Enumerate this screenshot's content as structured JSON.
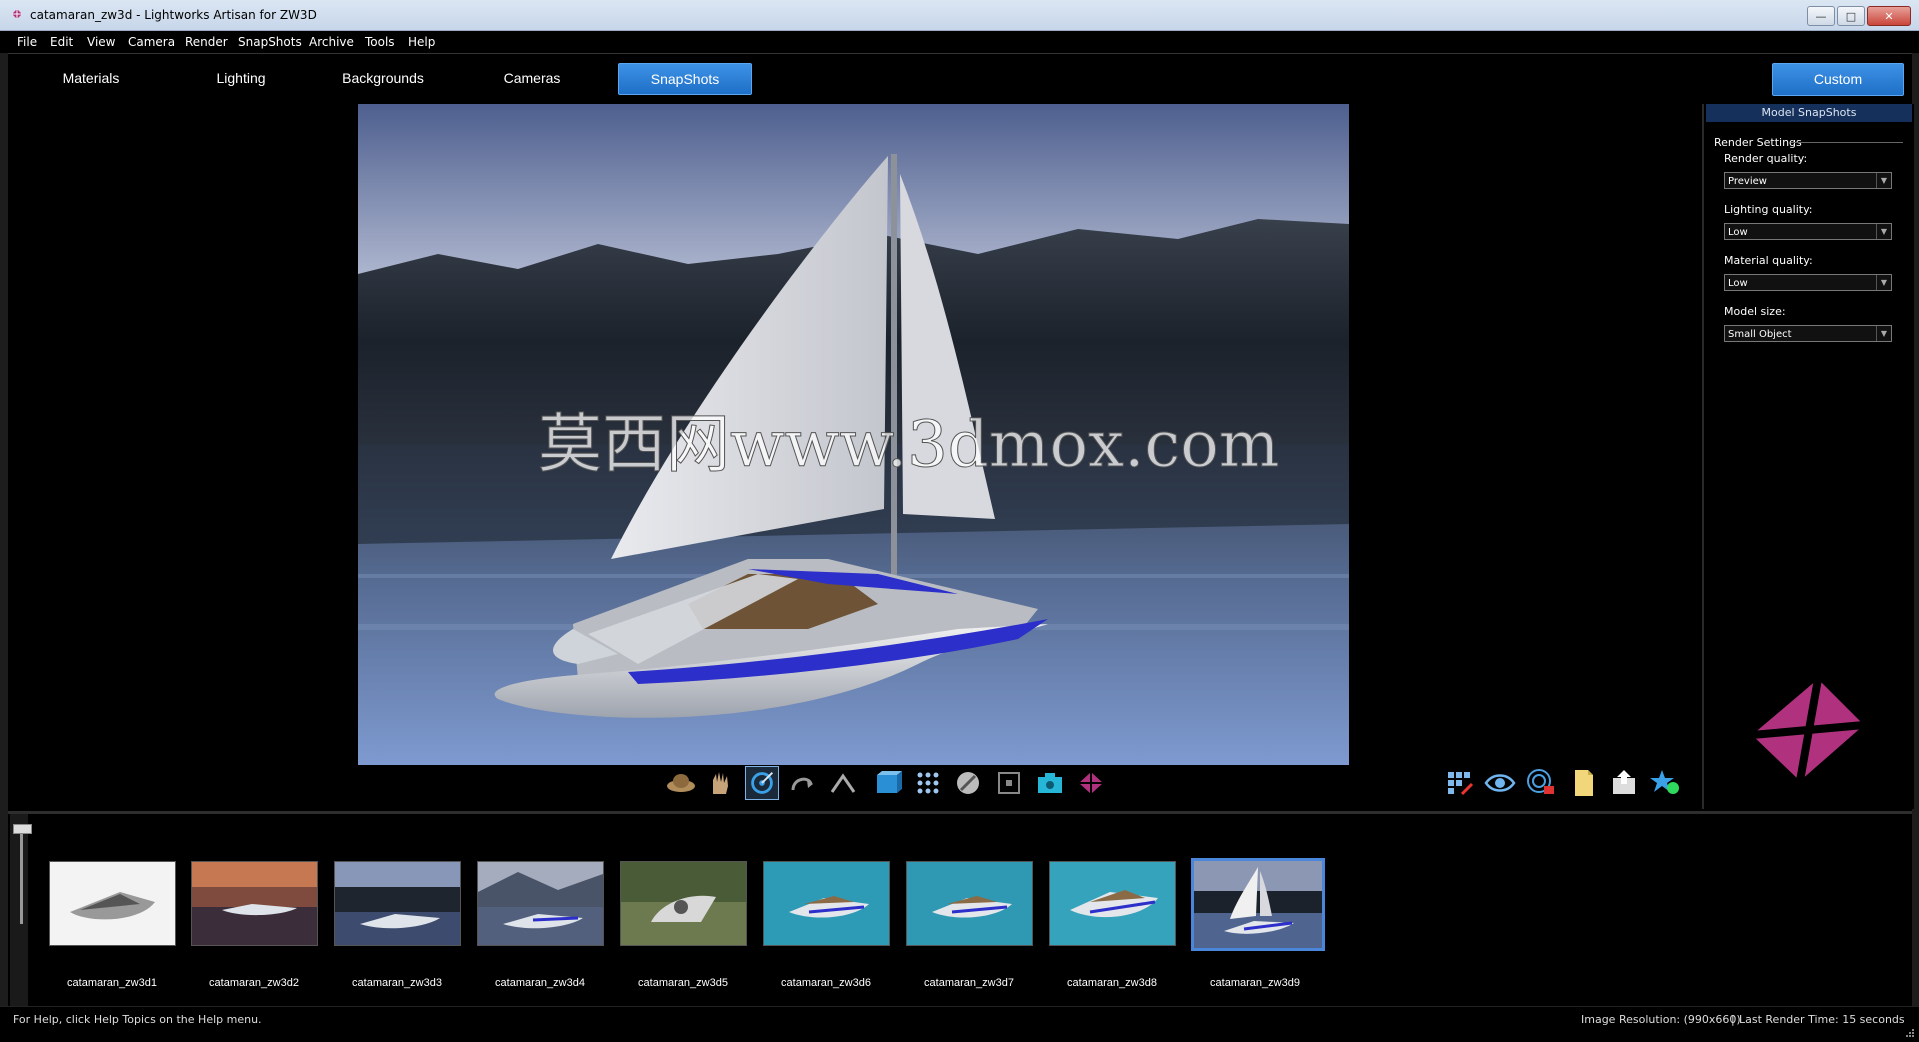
{
  "window": {
    "title": "catamaran_zw3d - Lightworks Artisan for ZW3D",
    "minimize": "—",
    "maximize": "□",
    "close": "✕"
  },
  "menu": [
    "File",
    "Edit",
    "View",
    "Camera",
    "Render",
    "SnapShots",
    "Archive",
    "Tools",
    "Help"
  ],
  "tabs": {
    "items": [
      "Materials",
      "Lighting",
      "Backgrounds",
      "Cameras",
      "SnapShots"
    ],
    "active": "SnapShots",
    "custom_label": "Custom"
  },
  "viewport": {
    "watermark": "莫西网www.3dmox.com"
  },
  "toolbar": {
    "center_icons": [
      "orbit-icon",
      "pan-hand-icon",
      "camera-target-icon",
      "rotate-icon",
      "arch-icon",
      "cube-icon",
      "grid-dots-icon",
      "no-entry-icon",
      "frame-icon",
      "camera-snap-icon",
      "artisan-logo-icon"
    ],
    "right_icons": [
      "grid-render-icon",
      "eye-icon",
      "target-render-icon",
      "document-icon",
      "export-icon",
      "star-icon"
    ],
    "selected": "camera-target-icon"
  },
  "panel": {
    "header": "Model SnapShots",
    "section": "Render Settings",
    "render_quality_label": "Render quality:",
    "render_quality_value": "Preview",
    "lighting_quality_label": "Lighting quality:",
    "lighting_quality_value": "Low",
    "material_quality_label": "Material quality:",
    "material_quality_value": "Low",
    "model_size_label": "Model size:",
    "model_size_value": "Small Object"
  },
  "snapshots": {
    "items": [
      "catamaran_zw3d1",
      "catamaran_zw3d2",
      "catamaran_zw3d3",
      "catamaran_zw3d4",
      "catamaran_zw3d5",
      "catamaran_zw3d6",
      "catamaran_zw3d7",
      "catamaran_zw3d8",
      "catamaran_zw3d9"
    ],
    "selected": "catamaran_zw3d9"
  },
  "status": {
    "help": "For Help, click Help Topics on the Help menu.",
    "resolution": "Image Resolution: (990x660)",
    "separator": "|",
    "render_time": "Last Render Time: 15 seconds"
  },
  "colors": {
    "accent": "#2a7fd8",
    "panel_header": "#14305b",
    "hull_stripe": "#2c2fc9",
    "logo": "#b0317e"
  }
}
